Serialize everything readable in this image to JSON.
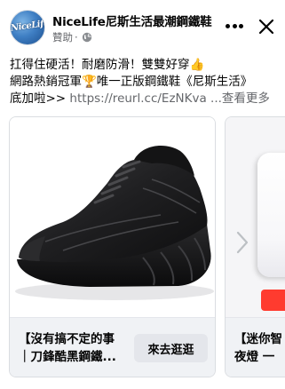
{
  "header": {
    "avatar_text": "NiceLife",
    "page_name": "NiceLife尼斯生活最潮鋼鐵鞋",
    "sponsored": "贊助",
    "separator": "·"
  },
  "caption": {
    "line1": "扛得住硬活！耐磨防滑！雙雙好穿👍",
    "line2": "網路熱銷冠軍🏆唯一正版鋼鐵鞋《尼斯生活》",
    "line3_prefix": "底加啦>> ",
    "link": "https://reurl.cc/EzNKva",
    "see_more": " ...查看更多"
  },
  "cards": [
    {
      "title_line1": "【沒有搞不定的事",
      "title_line2": "｜刀鋒酷黑鋼鐵...",
      "cta": "來去逛逛"
    },
    {
      "title_line1": "【迷你智",
      "title_line2": "夜燈 一"
    }
  ],
  "colors": {
    "text": "#050505",
    "secondary": "#65676b",
    "card_footer": "#f0f2f5",
    "button": "#e4e6eb"
  },
  "icons": [
    "globe-icon",
    "more-options-icon",
    "close-icon",
    "next-arrow-icon"
  ]
}
